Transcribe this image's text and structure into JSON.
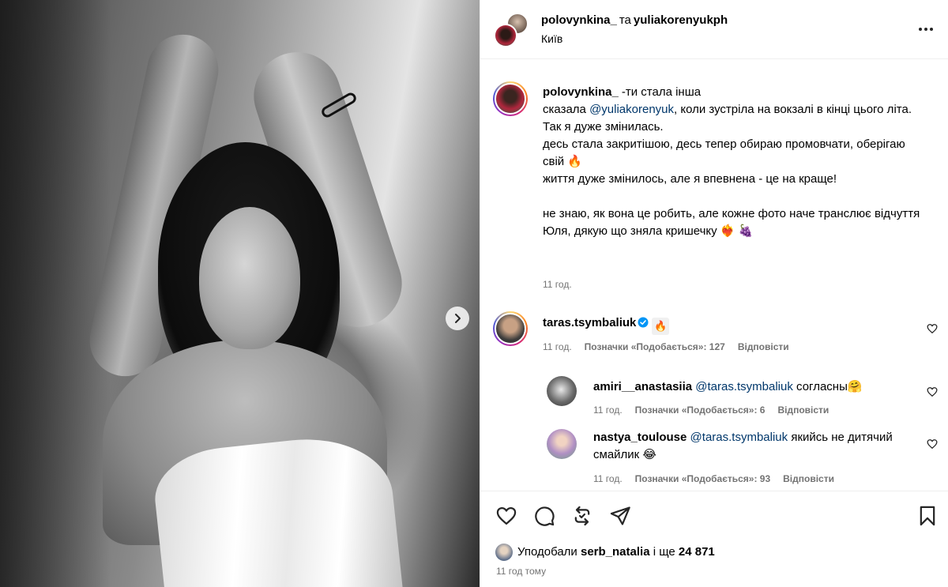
{
  "header": {
    "author1": "polovynkina_",
    "connector": "та",
    "author2": "yuliakorenyukph",
    "location": "Київ"
  },
  "caption": {
    "username": "polovynkina_",
    "line1": "-ти стала інша",
    "line2_pre": "сказала ",
    "line2_mention": "@yuliakorenyuk",
    "line2_post": ", коли зустріла на вокзалі в кінці цього літа.",
    "line3": "Так я дуже змінилась.",
    "line4": "десь стала закритішою, десь тепер обираю промовчати, оберігаю свій 🔥",
    "line5": "життя дуже змінилось, але я впевнена - це на краще!",
    "line6": "не знаю, як вона це робить, але кожне фото наче транслює відчуття",
    "line7": "Юля, дякую що зняла кришечку ❤️‍🔥 🍇",
    "time": "11 год."
  },
  "comments": [
    {
      "username": "taras.tsymbaliuk",
      "emoji": "🔥",
      "time": "11 год.",
      "likes": "Позначки «Подобається»: 127",
      "reply": "Відповісти"
    },
    {
      "username": "amiri__anastasiia",
      "mention": "@taras.tsymbaliuk",
      "text": " согласны🤗",
      "time": "11 год.",
      "likes": "Позначки «Подобається»: 6",
      "reply": "Відповісти"
    },
    {
      "username": "nastya_toulouse",
      "mention": "@taras.tsymbaliuk",
      "text": " якийсь не дитячий смайлик 😂",
      "time": "11 год.",
      "likes": "Позначки «Подобається»: 93",
      "reply": "Відповісти"
    }
  ],
  "footer": {
    "liked_prefix": "Уподобали ",
    "liked_user": "serb_natalia",
    "liked_mid": " і ще ",
    "liked_count": "24 871",
    "post_time": "11 год тому"
  },
  "icons": {
    "more": "more-horizontal-icon",
    "next": "chevron-right-icon",
    "like": "heart-icon",
    "comment": "comment-icon",
    "repost": "repost-icon",
    "share": "send-icon",
    "save": "bookmark-icon",
    "verified": "verified-badge-icon"
  },
  "colors": {
    "link": "#00376b",
    "muted": "#737373",
    "verified": "#0095f6",
    "divider": "#efefef"
  }
}
